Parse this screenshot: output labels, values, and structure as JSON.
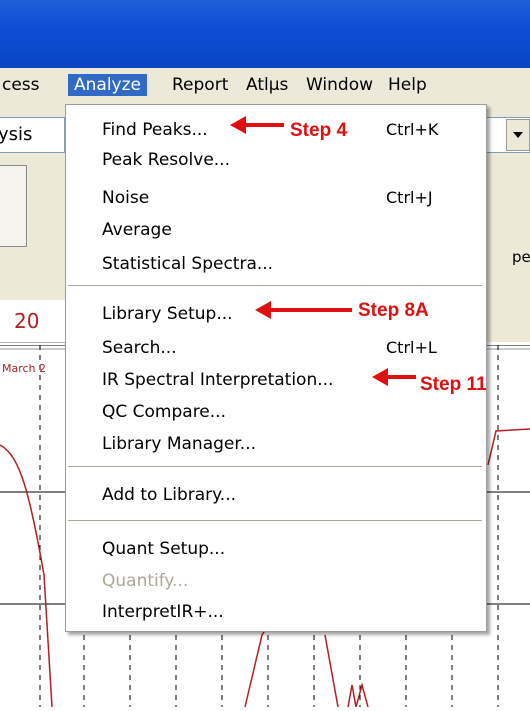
{
  "menubar": {
    "items": [
      "cess",
      "Analyze",
      "Report",
      "Atlμs",
      "Window",
      "Help"
    ]
  },
  "toolbar": {
    "combo_text": "ysis",
    "right_panel_text": "pe"
  },
  "field": {
    "value": "20"
  },
  "chart": {
    "title_fragment": "March 2"
  },
  "dropdown": {
    "items": [
      {
        "label": "Find Peaks...",
        "shortcut": "Ctrl+K"
      },
      {
        "label": "Peak Resolve...",
        "shortcut": ""
      },
      {
        "label": "Noise",
        "shortcut": "Ctrl+J"
      },
      {
        "label": "Average",
        "shortcut": ""
      },
      {
        "label": "Statistical Spectra...",
        "shortcut": ""
      },
      {
        "label": "Library Setup...",
        "shortcut": ""
      },
      {
        "label": "Search...",
        "shortcut": "Ctrl+L"
      },
      {
        "label": "IR Spectral Interpretation...",
        "shortcut": ""
      },
      {
        "label": "QC Compare...",
        "shortcut": ""
      },
      {
        "label": "Library Manager...",
        "shortcut": ""
      },
      {
        "label": "Add to Library...",
        "shortcut": ""
      },
      {
        "label": "Quant Setup...",
        "shortcut": ""
      },
      {
        "label": "Quantify...",
        "shortcut": "",
        "disabled": true
      },
      {
        "label": "InterpretIR+...",
        "shortcut": ""
      }
    ]
  },
  "annotations": [
    "Step 4",
    "Step 8A",
    "Step 11"
  ],
  "colors": {
    "title_bar": "#0b4ed4",
    "menu_highlight": "#316ac5",
    "annotation": "#e01010",
    "spectrum_line": "#b22020"
  }
}
